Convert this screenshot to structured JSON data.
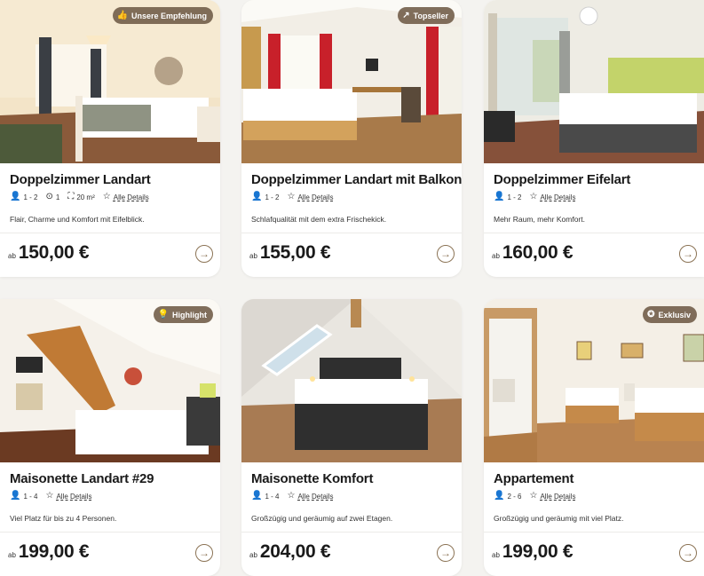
{
  "rooms": [
    {
      "title": "Doppelzimmer Landart",
      "badge": "Unsere Empfehlung",
      "badge_icon": "thumbs-up-icon",
      "persons": "1 - 2",
      "extra1": "1",
      "extra2": "20 m²",
      "details": "Alle Details",
      "description": "Flair, Charme und Komfort mit Eifelblick.",
      "price_prefix": "ab",
      "price": "150,00 €"
    },
    {
      "title": "Doppelzimmer Landart mit Balkon",
      "badge": "Topseller",
      "badge_icon": "trend-up-icon",
      "persons": "1 - 2",
      "details": "Alle Details",
      "description": "Schlafqualität mit dem extra Frischekick.",
      "price_prefix": "ab",
      "price": "155,00 €"
    },
    {
      "title": "Doppelzimmer Eifelart",
      "badge": "",
      "persons": "1 - 2",
      "details": "Alle Details",
      "description": "Mehr Raum, mehr Komfort.",
      "price_prefix": "ab",
      "price": "160,00 €"
    },
    {
      "title": "Maisonette Landart #29",
      "badge": "Highlight",
      "badge_icon": "lightbulb-icon",
      "persons": "1 - 4",
      "details": "Alle Details",
      "description": "Viel Platz für bis zu 4 Personen.",
      "price_prefix": "ab",
      "price": "199,00 €"
    },
    {
      "title": "Maisonette Komfort",
      "badge": "",
      "persons": "1 - 4",
      "details": "Alle Details",
      "description": "Großzügig und geräumig auf zwei Etagen.",
      "price_prefix": "ab",
      "price": "204,00 €"
    },
    {
      "title": "Appartement",
      "badge": "Exklusiv",
      "badge_icon": "star-badge-icon",
      "persons": "2 - 6",
      "details": "Alle Details",
      "description": "Großzügig und geräumig mit viel Platz.",
      "price_prefix": "ab",
      "price": "199,00 €"
    }
  ],
  "colors": {
    "accent": "#8b7355",
    "badge_bg": "#6e5a46",
    "background": "#f4f3f0"
  }
}
